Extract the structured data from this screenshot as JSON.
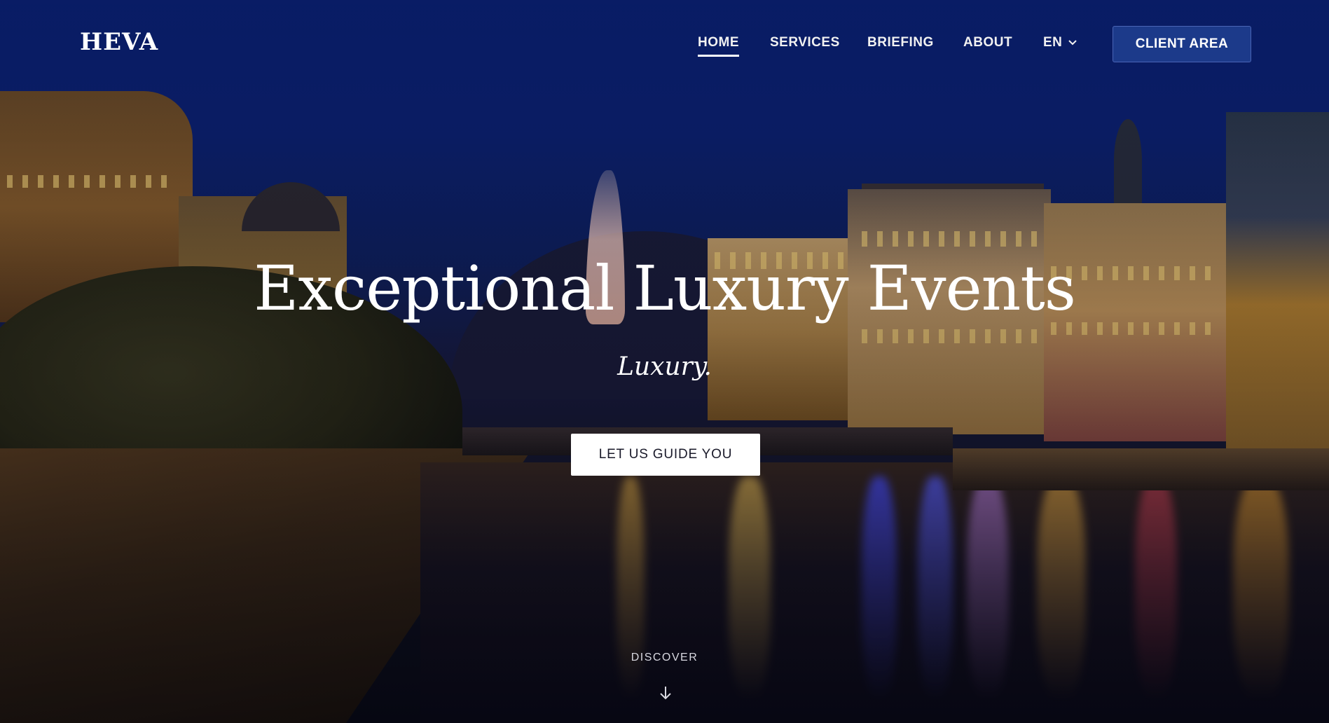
{
  "nav": {
    "logo": "HEVA",
    "items": [
      {
        "label": "HOME",
        "active": true
      },
      {
        "label": "SERVICES"
      },
      {
        "label": "BRIEFING"
      },
      {
        "label": "ABOUT"
      }
    ],
    "language": "EN",
    "client_area": "CLIENT AREA"
  },
  "hero": {
    "title": "Exceptional Luxury Events",
    "subtitle": "Luxury.",
    "cta": "LET US GUIDE YOU",
    "discover": "DISCOVER"
  },
  "icons": {
    "language_dropdown": "chevron-down-icon",
    "discover": "arrow-down-icon"
  },
  "colors": {
    "client_button_bg": "#1c3a8a",
    "cta_bg": "#ffffff",
    "text": "#ffffff"
  }
}
